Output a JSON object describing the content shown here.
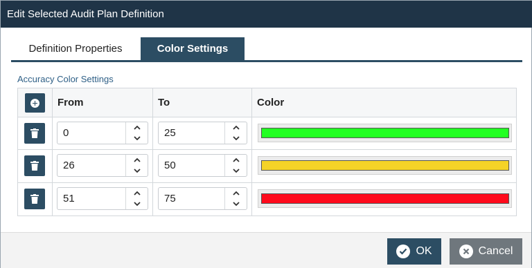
{
  "window": {
    "title": "Edit Selected Audit Plan Definition"
  },
  "tabs": [
    {
      "label": "Definition Properties",
      "active": false
    },
    {
      "label": "Color Settings",
      "active": true
    }
  ],
  "section": {
    "label": "Accuracy Color Settings"
  },
  "table": {
    "columns": {
      "from": "From",
      "to": "To",
      "color": "Color"
    },
    "rows": [
      {
        "from": "0",
        "to": "25",
        "color": "#22ff22"
      },
      {
        "from": "26",
        "to": "50",
        "color": "#f5d327"
      },
      {
        "from": "51",
        "to": "75",
        "color": "#ff0a1c"
      }
    ]
  },
  "footer": {
    "ok_label": "OK",
    "cancel_label": "Cancel"
  },
  "icons": {
    "add": "plus-circle-icon",
    "delete": "trash-icon",
    "spin_up": "chevron-up-icon",
    "spin_down": "chevron-down-icon",
    "ok": "check-circle-icon",
    "cancel": "x-circle-icon"
  },
  "colors": {
    "title_bar": "#1f3447",
    "accent": "#2c4d63",
    "cancel_button": "#6f777d",
    "section_label": "#2e5f86"
  }
}
